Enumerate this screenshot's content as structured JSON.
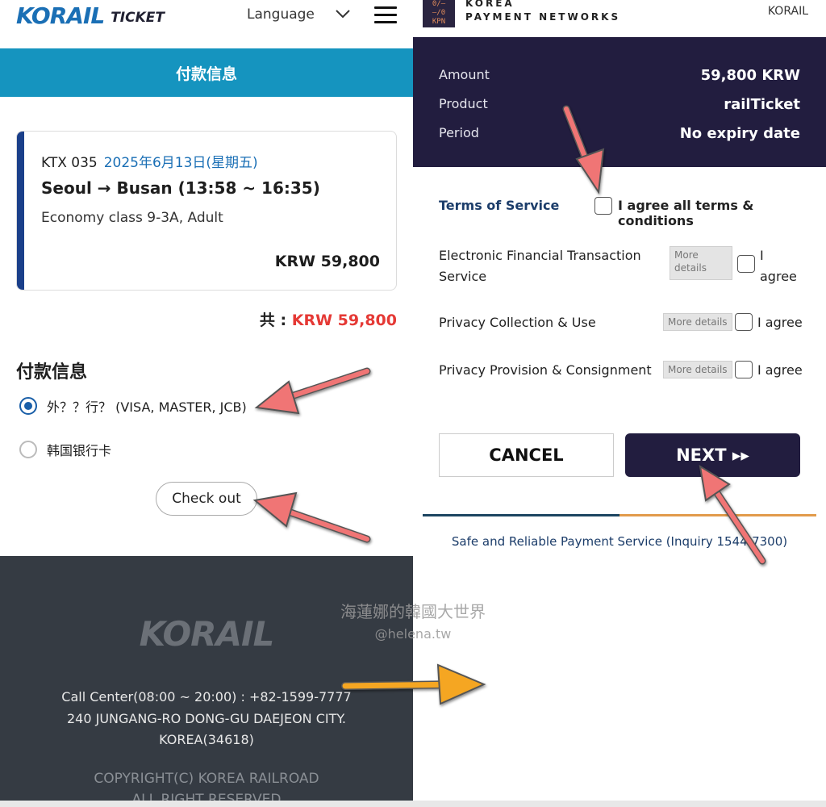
{
  "left": {
    "logo": {
      "main": "KORAIL",
      "sub": "TICKET"
    },
    "language_label": "Language",
    "header_title": "付款信息",
    "ticket": {
      "train": "KTX  035",
      "date": "2025年6月13日(星期五)",
      "route": "Seoul → Busan (13:58 ~ 16:35)",
      "class_info": "Economy class 9-3A, Adult",
      "price": "KRW 59,800"
    },
    "total_label": "共 : ",
    "total_value": "KRW 59,800",
    "payment_title": "付款信息",
    "payment_options": [
      {
        "label": "外？？行？ (VISA, MASTER, JCB)",
        "selected": true
      },
      {
        "label": "韩国银行卡",
        "selected": false
      }
    ],
    "checkout_label": "Check out",
    "footer": {
      "logo": "KORAIL",
      "call_center": "Call Center(08:00 ~ 20:00) : +82-1599-7777",
      "address1": "240 JUNGANG-RO DONG-GU DAEJEON CITY.",
      "address2": "KOREA(34618)",
      "copyright1": "COPYRIGHT(C) KOREA RAILROAD",
      "copyright2": "ALL RIGHT RESERVED"
    }
  },
  "right": {
    "kpn_logo": "KPN",
    "kpn_name_line1": "KOREA",
    "kpn_name_line2": "PAYMENT NETWORKS",
    "merchant": "KORAIL",
    "summary": [
      {
        "key": "Amount",
        "value": "59,800 KRW"
      },
      {
        "key": "Product",
        "value": "railTicket"
      },
      {
        "key": "Period",
        "value": "No expiry date"
      }
    ],
    "terms_label": "Terms of Service",
    "agree_all": "I agree all terms & conditions",
    "terms": [
      {
        "name": "Electronic Financial Transaction Service",
        "more": "More details",
        "agree": "I agree"
      },
      {
        "name": "Privacy Collection & Use",
        "more": "More details",
        "agree": "I agree"
      },
      {
        "name": "Privacy Provision & Consignment",
        "more": "More details",
        "agree": "I agree"
      }
    ],
    "cancel_label": "CANCEL",
    "next_label": "NEXT ▸▸",
    "safe_text": "Safe and Reliable Payment Service (Inquiry 1544-7300)"
  },
  "watermark": {
    "line1": "海蓮娜的韓國大世界",
    "line2": "@helena.tw"
  },
  "colors": {
    "korail_blue": "#1594bf",
    "ticket_accent": "#1a3f8a",
    "price_red": "#e53935",
    "kpn_navy": "#221d3f",
    "footer_dark": "#353b43",
    "arrow_red": "#f07575",
    "arrow_orange": "#f5a623"
  }
}
